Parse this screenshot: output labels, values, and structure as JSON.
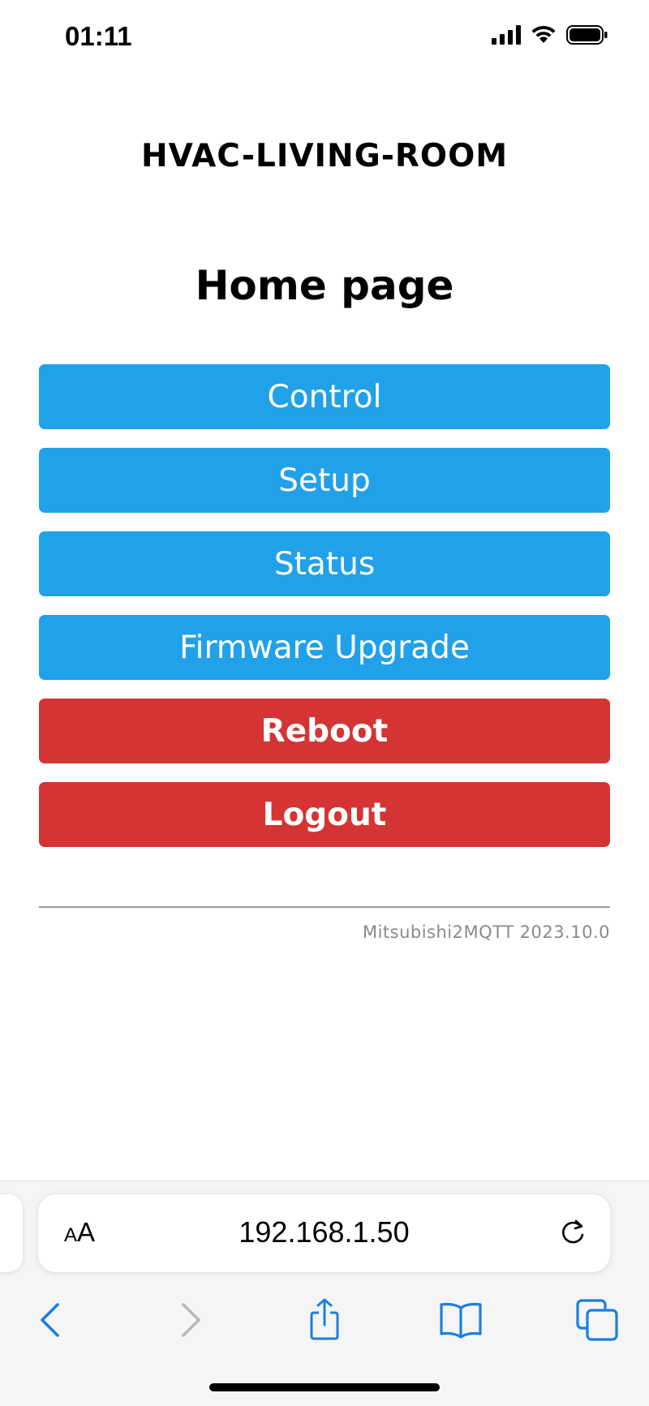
{
  "status_bar": {
    "time": "01:11",
    "icons": [
      "cellular-signal-icon",
      "wifi-icon",
      "battery-icon"
    ]
  },
  "page": {
    "device_name": "HVAC-LIVING-ROOM",
    "title": "Home page",
    "menu": [
      {
        "label": "Control",
        "color": "#21a1e9"
      },
      {
        "label": "Setup",
        "color": "#21a1e9"
      },
      {
        "label": "Status",
        "color": "#21a1e9"
      },
      {
        "label": "Firmware Upgrade",
        "color": "#21a1e9"
      },
      {
        "label": "Reboot",
        "color": "#d53434"
      },
      {
        "label": "Logout",
        "color": "#d53434"
      }
    ],
    "footer": "Mitsubishi2MQTT 2023.10.0"
  },
  "browser": {
    "aa_small": "A",
    "aa_large": "A",
    "url": "192.168.1.50",
    "toolbar_icons": [
      "back-icon",
      "forward-icon",
      "share-icon",
      "bookmarks-icon",
      "tabs-icon"
    ],
    "accent_color": "#1a7fe0"
  }
}
